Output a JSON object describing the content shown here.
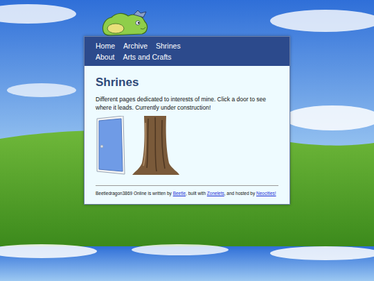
{
  "nav": {
    "items": [
      {
        "label": "Home"
      },
      {
        "label": "Archive"
      },
      {
        "label": "Shrines"
      },
      {
        "label": "About"
      },
      {
        "label": "Arts and Crafts"
      }
    ]
  },
  "page": {
    "heading": "Shrines",
    "description": "Different pages dedicated to interests of mine. Click a door to see where it leads. Currently under construction!"
  },
  "doors": [
    {
      "kind": "door"
    },
    {
      "kind": "tree"
    }
  ],
  "footer": [
    {
      "text": "Beetledragon3869 Online is written by ",
      "link": false
    },
    {
      "text": "Beetle",
      "link": true
    },
    {
      "text": ", built with ",
      "link": false
    },
    {
      "text": "Zonelets",
      "link": true
    },
    {
      "text": ", and hosted by ",
      "link": false
    },
    {
      "text": "Neocities!",
      "link": true
    }
  ]
}
